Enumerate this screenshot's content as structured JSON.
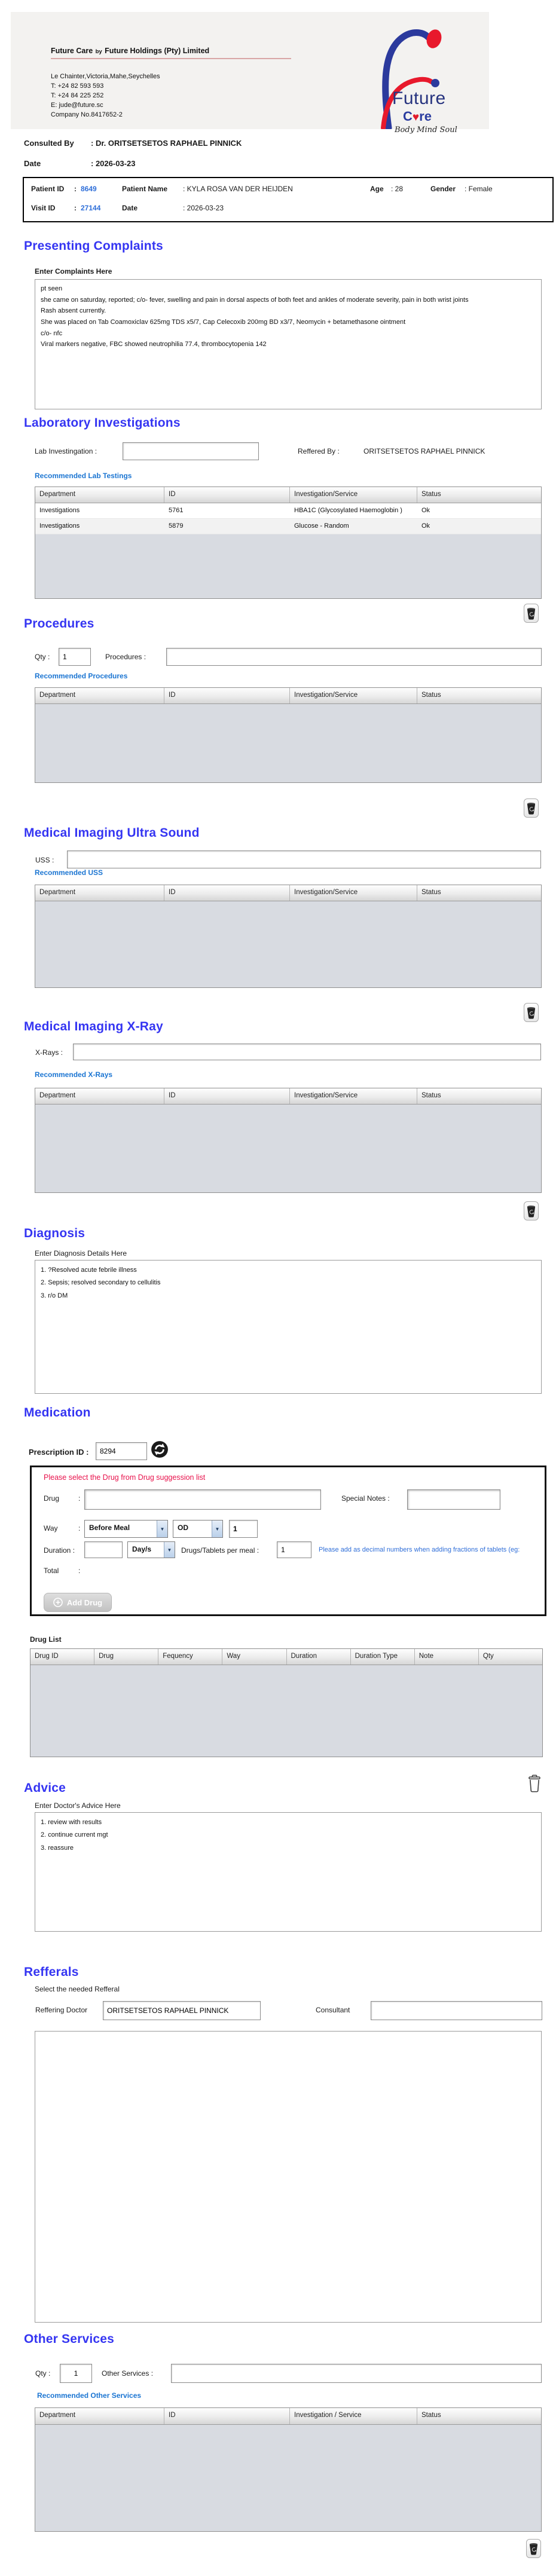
{
  "ui": {
    "colon": ":",
    "dropdown_arrow": "▼"
  },
  "header": {
    "company_main": "Future Care",
    "company_by": "by",
    "company_rest": "Future Holdings (Pty) Limited",
    "address": "Le Chainter,Victoria,Mahe,Seychelles",
    "phone1": "T: +24  82 593 593",
    "phone2": "T: +24  84 225 252",
    "email": "E: jude@future.sc",
    "company_no": "Company No.8417652-2",
    "logo": {
      "word1": "Future",
      "care_pre": "C",
      "heart": "♥",
      "care_post": "re",
      "tagline": "Body Mind Soul"
    }
  },
  "consult": {
    "label": "Consulted By",
    "value": ":  Dr.  ORITSETSETOS RAPHAEL PINNICK",
    "date_label": "Date",
    "date_value": ":  2026-03-23"
  },
  "patient": {
    "pid_label": "Patient ID",
    "pid": "8649",
    "pname_label": "Patient Name",
    "pname": ": KYLA ROSA VAN DER HEIJDEN",
    "age_label": "Age",
    "age": ": 28",
    "gender_label": "Gender",
    "gender": ": Female",
    "visit_label": "Visit ID",
    "visit": "27144",
    "date_label": "Date",
    "date": ": 2026-03-23"
  },
  "presenting": {
    "title": "Presenting Complaints",
    "label": "Enter Complaints Here",
    "text": "pt seen\nshe came on saturday, reported; c/o- fever, swelling and pain in dorsal aspects of both feet and ankles of moderate severity, pain in both wrist joints\nRash absent currently.\nShe was placed on Tab Coamoxiclav 625mg TDS x5/7, Cap Celecoxib 200mg BD x3/7, Neomycin + betamethasone ointment\nc/o- nfc\nViral markers negative, FBC showed neutrophilia 77.4, thrombocytopenia 142"
  },
  "lab": {
    "title": "Laboratory  Investigations",
    "input_label": "Lab Investingation :",
    "referred_label": "Reffered By :",
    "referred_value": "ORITSETSETOS RAPHAEL PINNICK",
    "link": "Recommended Lab Testings",
    "table": {
      "headers": [
        "Department",
        "ID",
        "Investigation/Service",
        "Status"
      ],
      "rows": [
        {
          "department": "Investigations",
          "id": "5761",
          "service": "HBA1C (Glycosylated Haemoglobin )",
          "status": "Ok"
        },
        {
          "department": "Investigations",
          "id": "5879",
          "service": "Glucose - Random",
          "status": "Ok"
        }
      ]
    }
  },
  "procedures": {
    "title": "Procedures",
    "qty_label": "Qty :",
    "qty_value": "1",
    "input_label": "Procedures :",
    "link": "Recommended Procedures",
    "table": {
      "headers": [
        "Department",
        "ID",
        "Investigation/Service",
        "Status"
      ]
    }
  },
  "uss": {
    "title": "Medical Imaging Ultra Sound",
    "input_label": "USS :",
    "link": "Recommended USS",
    "table": {
      "headers": [
        "Department",
        "ID",
        "Investigation/Service",
        "Status"
      ]
    }
  },
  "xray": {
    "title": "Medical Imaging X-Ray",
    "input_label": "X-Rays :",
    "link": "Recommended X-Rays",
    "table": {
      "headers": [
        "Department",
        "ID",
        "Investigation/Service",
        "Status"
      ]
    }
  },
  "diagnosis": {
    "title": "Diagnosis",
    "label": "Enter Diagnosis Details Here",
    "text": "1. ?Resolved acute febrile illness\n2. Sepsis; resolved secondary to cellulitis\n3. r/o DM"
  },
  "medication": {
    "title": "Medication",
    "prescription_label": "Prescription ID :",
    "prescription_id": "8294",
    "warning": "Please select the Drug from Drug suggession list",
    "drug_label": "Drug",
    "special_notes_label": "Special Notes   :",
    "way_label": "Way",
    "way_value": "Before Meal",
    "freq_value": "OD",
    "way_qty": "1",
    "duration_label": "Duration :",
    "duration_unit": "Day/s",
    "per_meal_label": "Drugs/Tablets per meal :",
    "per_meal_value": "1",
    "hint": "Please add as decimal numbers when adding fractions of tablets (eg:",
    "total_label": "Total",
    "add_drug_label": "Add Drug",
    "drug_list_label": "Drug List",
    "table": {
      "headers": [
        "Drug ID",
        "Drug",
        "Fequency",
        "Way",
        "Duration",
        "Duration Type",
        "Note",
        "Qty"
      ]
    }
  },
  "advice": {
    "title": "Advice",
    "label": "Enter Doctor's Advice Here",
    "text": "1. review with results\n2. continue current mgt\n3. reassure"
  },
  "referrals": {
    "title": "Refferals",
    "label": "Select the needed Refferal",
    "doctor_label": "Reffering Doctor",
    "doctor_value": "ORITSETSETOS RAPHAEL PINNICK",
    "consultant_label": "Consultant"
  },
  "other": {
    "title": "Other Services",
    "qty_label": "Qty :",
    "qty_value": "1",
    "input_label": "Other Services :",
    "link": "Recommended Other Services",
    "table": {
      "headers": [
        "Department",
        "ID",
        "Investigation / Service",
        "Status"
      ]
    }
  }
}
